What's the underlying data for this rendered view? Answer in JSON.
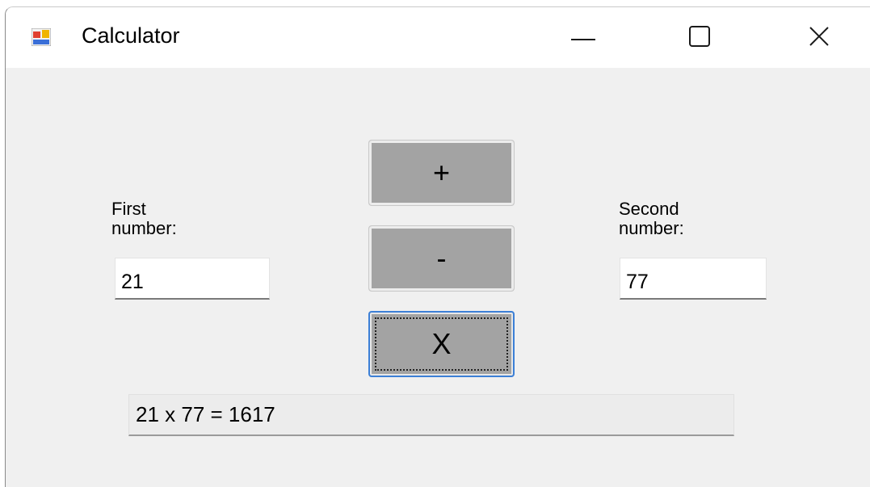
{
  "window": {
    "title": "Calculator",
    "app_icon": "winforms-app-icon",
    "controls": {
      "minimize_icon": "minimize-icon",
      "maximize_icon": "maximize-icon",
      "close_icon": "close-icon"
    }
  },
  "form": {
    "first_label": "First\nnumber:",
    "first_value": "21",
    "second_label": "Second\nnumber:",
    "second_value": "77",
    "buttons": {
      "plus_label": "+",
      "minus_label": "-",
      "multiply_label": "X"
    },
    "result": "21 x 77 = 1617"
  },
  "colors": {
    "form_background": "#f0f0f0",
    "button_face": "#a3a3a3",
    "focus_border": "#3c7fd6"
  }
}
